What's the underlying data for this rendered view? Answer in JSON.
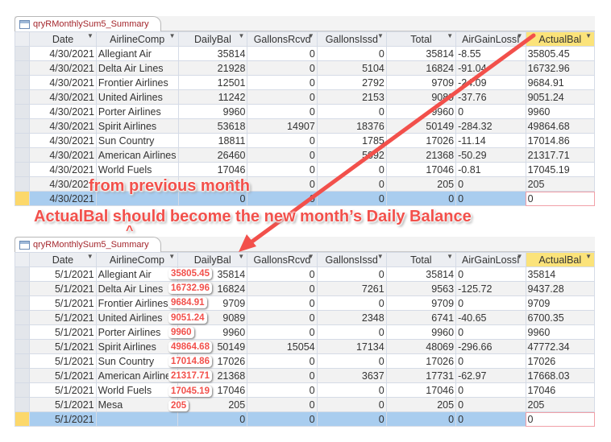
{
  "tables": [
    {
      "tab_title": "qryRMonthlySum5_Summary",
      "columns": [
        "Date",
        "AirlineComp",
        "DailyBal",
        "GallonsRcvd",
        "GallonsIssd",
        "Total",
        "AirGainLossI",
        "ActualBal"
      ],
      "rows": [
        [
          "4/30/2021",
          "Allegiant Air",
          "35814",
          "0",
          "0",
          "35814",
          "-8.55",
          "35805.45"
        ],
        [
          "4/30/2021",
          "Delta Air Lines",
          "21928",
          "0",
          "5104",
          "16824",
          "-91.04",
          "16732.96"
        ],
        [
          "4/30/2021",
          "Frontier Airlines",
          "12501",
          "0",
          "2792",
          "9709",
          "-24.09",
          "9684.91"
        ],
        [
          "4/30/2021",
          "United Airlines",
          "11242",
          "0",
          "2153",
          "9089",
          "-37.76",
          "9051.24"
        ],
        [
          "4/30/2021",
          "Porter Airlines",
          "9960",
          "0",
          "0",
          "9960",
          "0",
          "9960"
        ],
        [
          "4/30/2021",
          "Spirit Airlines",
          "53618",
          "14907",
          "18376",
          "50149",
          "-284.32",
          "49864.68"
        ],
        [
          "4/30/2021",
          "Sun Country",
          "18811",
          "0",
          "1785",
          "17026",
          "-11.14",
          "17014.86"
        ],
        [
          "4/30/2021",
          "American Airlines",
          "26460",
          "0",
          "5092",
          "21368",
          "-50.29",
          "21317.71"
        ],
        [
          "4/30/2021",
          "World Fuels",
          "17046",
          "0",
          "0",
          "17046",
          "-0.81",
          "17045.19"
        ],
        [
          "4/30/2021",
          "",
          "205",
          "0",
          "0",
          "205",
          "0",
          "205"
        ],
        [
          "4/30/2021",
          "",
          "0",
          "0",
          "0",
          "0",
          "0",
          "0"
        ]
      ]
    },
    {
      "tab_title": "qryRMonthlySum5_Summary",
      "columns": [
        "Date",
        "AirlineComp",
        "DailyBal",
        "GallonsRcvd",
        "GallonsIssd",
        "Total",
        "AirGainLossI",
        "ActualBal"
      ],
      "rows": [
        [
          "5/1/2021",
          "Allegiant Air",
          "35814",
          "0",
          "0",
          "35814",
          "0",
          "35814"
        ],
        [
          "5/1/2021",
          "Delta Air Lines",
          "16824",
          "0",
          "7261",
          "9563",
          "-125.72",
          "9437.28"
        ],
        [
          "5/1/2021",
          "Frontier Airlines",
          "9709",
          "0",
          "0",
          "9709",
          "0",
          "9709"
        ],
        [
          "5/1/2021",
          "United Airlines",
          "9089",
          "0",
          "2348",
          "6741",
          "-40.65",
          "6700.35"
        ],
        [
          "5/1/2021",
          "Porter Airlines",
          "9960",
          "0",
          "0",
          "9960",
          "0",
          "9960"
        ],
        [
          "5/1/2021",
          "Spirit Airlines",
          "50149",
          "15054",
          "17134",
          "48069",
          "-296.66",
          "47772.34"
        ],
        [
          "5/1/2021",
          "Sun Country",
          "17026",
          "0",
          "0",
          "17026",
          "0",
          "17026"
        ],
        [
          "5/1/2021",
          "American Airlines",
          "21368",
          "0",
          "3637",
          "17731",
          "-62.97",
          "17668.03"
        ],
        [
          "5/1/2021",
          "World Fuels",
          "17046",
          "0",
          "0",
          "17046",
          "0",
          "17046"
        ],
        [
          "5/1/2021",
          "Mesa",
          "205",
          "0",
          "0",
          "205",
          "0",
          "205"
        ],
        [
          "5/1/2021",
          "",
          "0",
          "0",
          "0",
          "0",
          "0",
          "0"
        ]
      ]
    }
  ],
  "annotations": {
    "from_previous": "from previous month",
    "main": "ActualBal should become the new month’s Daily Balance",
    "caret": "^",
    "callouts": [
      "35805.45",
      "16732.96",
      "9684.91",
      "9051.24",
      "9960",
      "49864.68",
      "17014.86",
      "21317.71",
      "17045.19",
      "205"
    ],
    "color": "#f2504b"
  }
}
